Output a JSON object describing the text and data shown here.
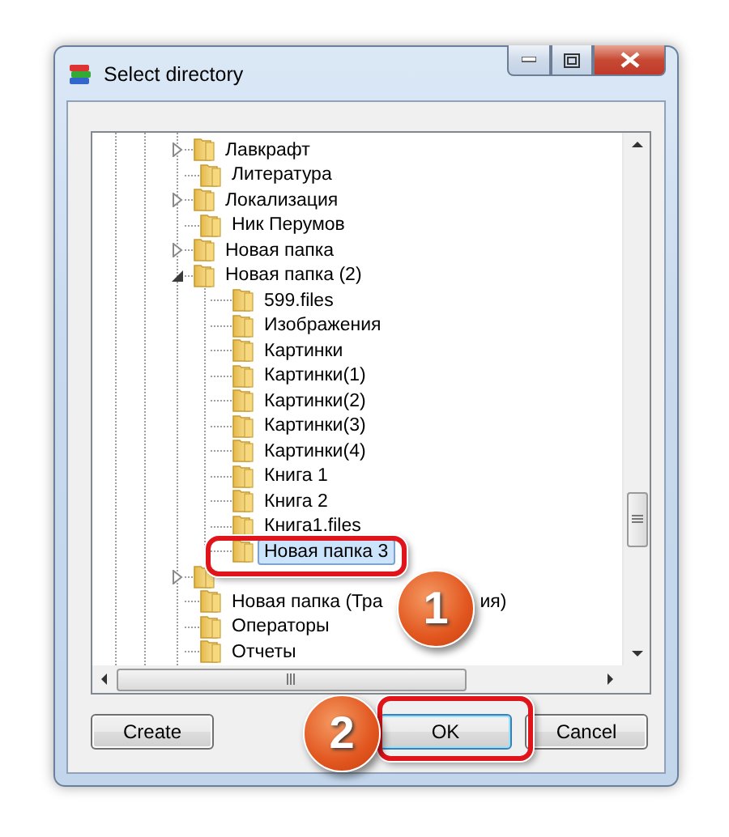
{
  "window": {
    "title": "Select directory"
  },
  "tree": [
    {
      "label": "Лавкрафт",
      "kind": "collapsed",
      "selected": false
    },
    {
      "label": "Литература",
      "kind": "leaf",
      "selected": false
    },
    {
      "label": "Локализация",
      "kind": "collapsed",
      "selected": false
    },
    {
      "label": "Ник Перумов",
      "kind": "leaf",
      "selected": false
    },
    {
      "label": "Новая папка",
      "kind": "collapsed",
      "selected": false
    },
    {
      "label": "Новая папка (2)",
      "kind": "expanded",
      "selected": false,
      "children": [
        {
          "label": "599.files",
          "kind": "leaf",
          "selected": false
        },
        {
          "label": "Изображения",
          "kind": "leaf",
          "selected": false
        },
        {
          "label": "Картинки",
          "kind": "leaf",
          "selected": false
        },
        {
          "label": "Картинки(1)",
          "kind": "leaf",
          "selected": false
        },
        {
          "label": "Картинки(2)",
          "kind": "leaf",
          "selected": false
        },
        {
          "label": "Картинки(3)",
          "kind": "leaf",
          "selected": false
        },
        {
          "label": "Картинки(4)",
          "kind": "leaf",
          "selected": false
        },
        {
          "label": "Книга 1",
          "kind": "leaf",
          "selected": false
        },
        {
          "label": "Книга 2",
          "kind": "leaf",
          "selected": false
        },
        {
          "label": "Книга1.files",
          "kind": "leaf",
          "selected": false
        },
        {
          "label": "Новая папка 3",
          "kind": "leaf",
          "selected": true
        }
      ]
    },
    {
      "kind": "collapsed"
    },
    {
      "label": "Новая папка (Тра",
      "label_end": "ия)",
      "kind": "leaf",
      "selected": false
    },
    {
      "label": "Операторы",
      "kind": "leaf",
      "selected": false
    },
    {
      "label": "Отчеты",
      "kind": "leaf",
      "selected": false
    }
  ],
  "buttons": [
    {
      "label": "Create",
      "default": false
    },
    {
      "label": "OK",
      "default": true
    },
    {
      "label": "Cancel",
      "default": false
    }
  ],
  "callouts": [
    {
      "number": "1"
    },
    {
      "number": "2"
    }
  ]
}
